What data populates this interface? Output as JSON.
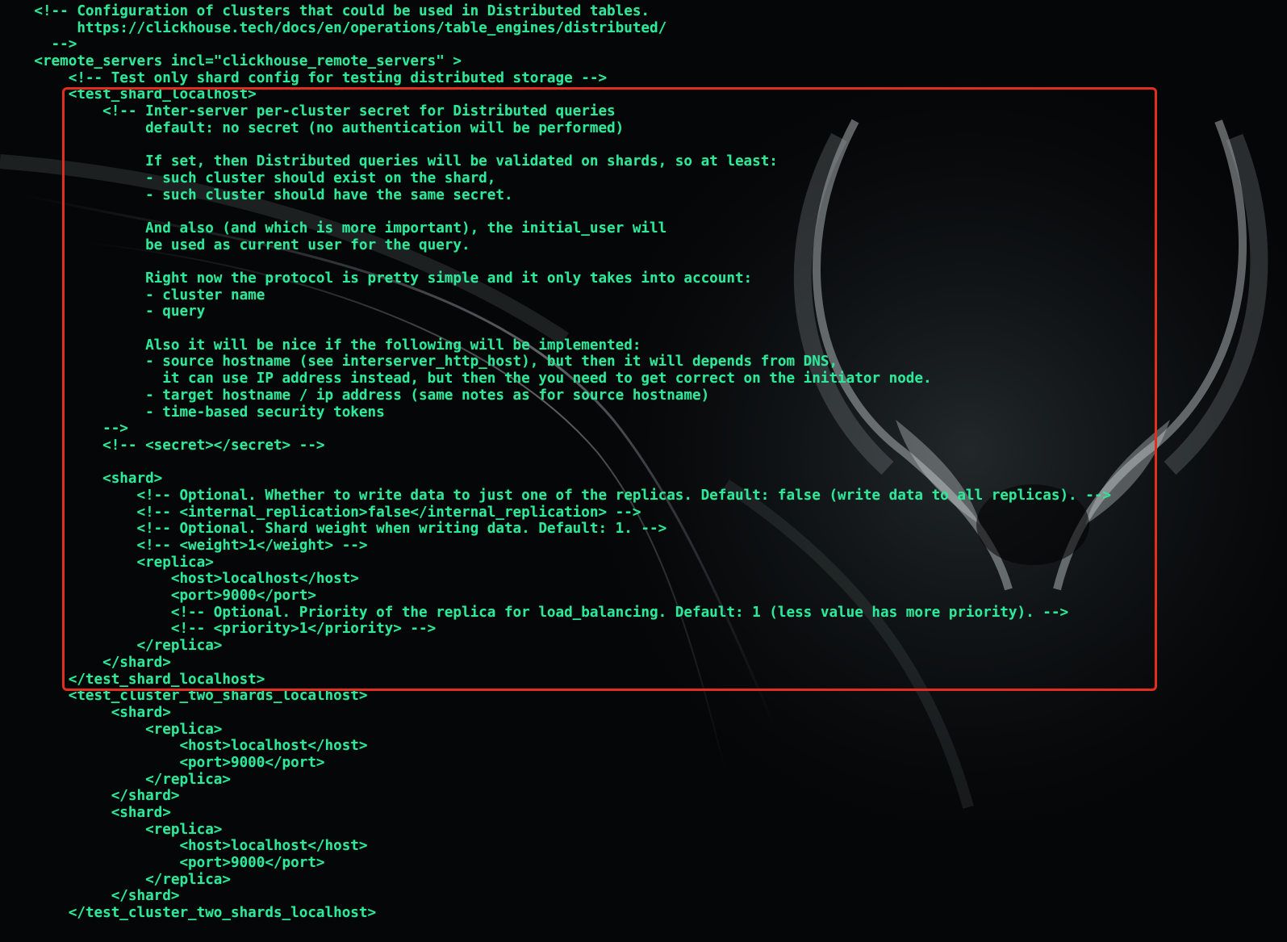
{
  "theme": {
    "text_color": "#2ee89a",
    "highlight_color": "#e32d1f",
    "background": "#050607"
  },
  "code_lines": [
    "    <!-- Configuration of clusters that could be used in Distributed tables.",
    "         https://clickhouse.tech/docs/en/operations/table_engines/distributed/",
    "      -->",
    "    <remote_servers incl=\"clickhouse_remote_servers\" >",
    "        <!-- Test only shard config for testing distributed storage -->",
    "        <test_shard_localhost>",
    "            <!-- Inter-server per-cluster secret for Distributed queries",
    "                 default: no secret (no authentication will be performed)",
    "",
    "                 If set, then Distributed queries will be validated on shards, so at least:",
    "                 - such cluster should exist on the shard,",
    "                 - such cluster should have the same secret.",
    "",
    "                 And also (and which is more important), the initial_user will",
    "                 be used as current user for the query.",
    "",
    "                 Right now the protocol is pretty simple and it only takes into account:",
    "                 - cluster name",
    "                 - query",
    "",
    "                 Also it will be nice if the following will be implemented:",
    "                 - source hostname (see interserver_http_host), but then it will depends from DNS,",
    "                   it can use IP address instead, but then the you need to get correct on the initiator node.",
    "                 - target hostname / ip address (same notes as for source hostname)",
    "                 - time-based security tokens",
    "            -->",
    "            <!-- <secret></secret> -->",
    "",
    "            <shard>",
    "                <!-- Optional. Whether to write data to just one of the replicas. Default: false (write data to all replicas). -->",
    "                <!-- <internal_replication>false</internal_replication> -->",
    "                <!-- Optional. Shard weight when writing data. Default: 1. -->",
    "                <!-- <weight>1</weight> -->",
    "                <replica>",
    "                    <host>localhost</host>",
    "                    <port>9000</port>",
    "                    <!-- Optional. Priority of the replica for load_balancing. Default: 1 (less value has more priority). -->",
    "                    <!-- <priority>1</priority> -->",
    "                </replica>",
    "            </shard>",
    "        </test_shard_localhost>",
    "        <test_cluster_two_shards_localhost>",
    "             <shard>",
    "                 <replica>",
    "                     <host>localhost</host>",
    "                     <port>9000</port>",
    "                 </replica>",
    "             </shard>",
    "             <shard>",
    "                 <replica>",
    "                     <host>localhost</host>",
    "                     <port>9000</port>",
    "                 </replica>",
    "             </shard>",
    "        </test_cluster_two_shards_localhost>"
  ]
}
